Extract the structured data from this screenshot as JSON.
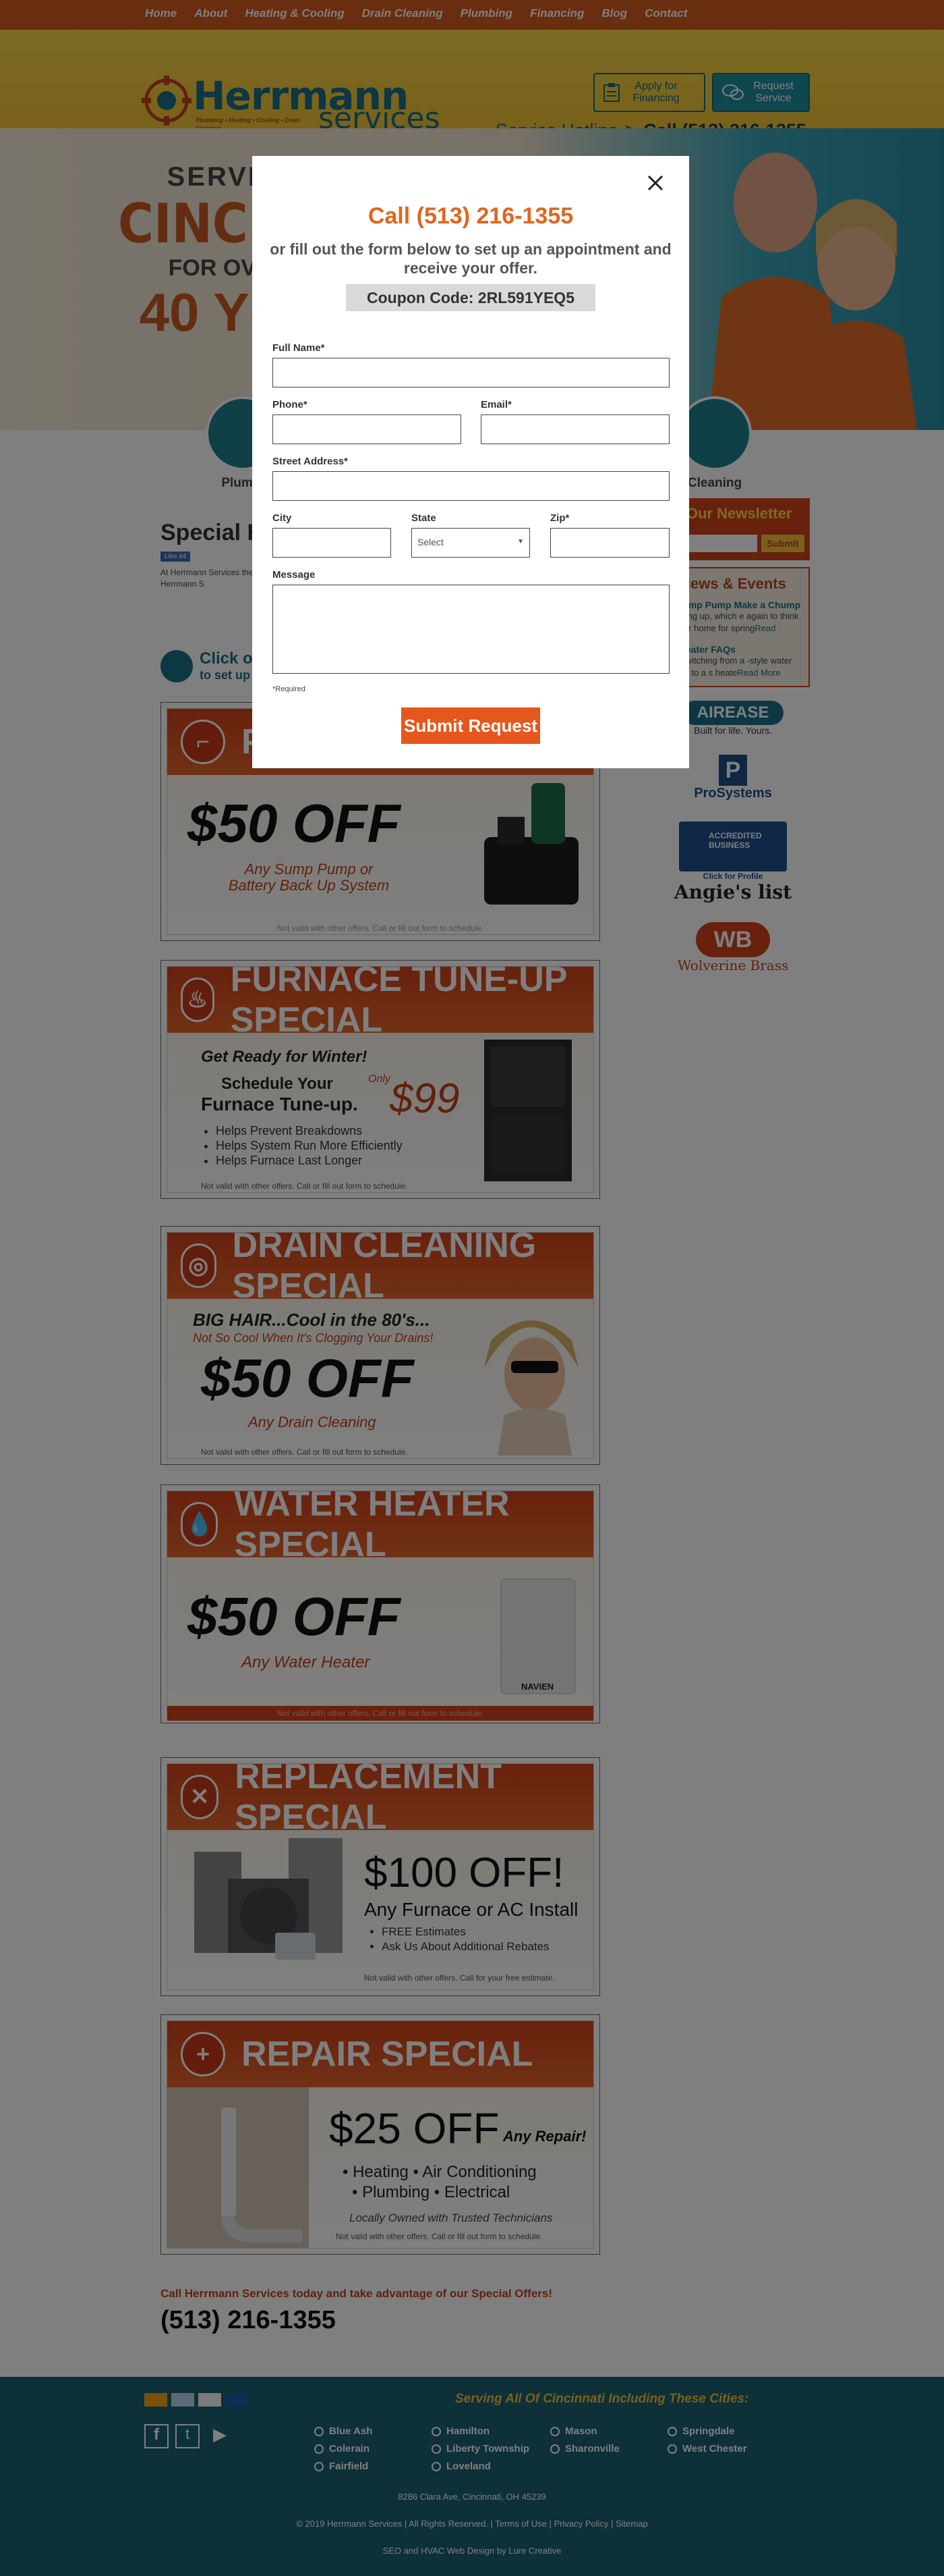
{
  "nav": {
    "items": [
      "Home",
      "About",
      "Heating & Cooling",
      "Drain Cleaning",
      "Plumbing",
      "Financing",
      "Blog",
      "Contact"
    ]
  },
  "header": {
    "logo_name": "Herrmann",
    "logo_services": "services",
    "logo_tagline": "Plumbing • Heating • Cooling • Drain Cleaning",
    "apply_label": "Apply for Financing",
    "request_label": "Request Service",
    "hotline_label": "Service Hotline ➤",
    "hotline_phone": "Call (513) 216-1355"
  },
  "hero": {
    "line1": "SERVI",
    "line2": "CINCIN",
    "line3": "FOR OV",
    "line4": "40 YE"
  },
  "services": [
    {
      "label": "Plumbi"
    },
    {
      "label": "Cleaning"
    }
  ],
  "main": {
    "title": "Special He",
    "like": "Like 44",
    "intro": "At Herrmann Services the special offers belo take advantage of an choosing Herrmann S",
    "click_text": "Click o",
    "click_sub": "to set up a"
  },
  "coupons": {
    "sump": {
      "banner": "P",
      "big": "$50 OFF",
      "sub": "Any Sump Pump or Battery Back Up System",
      "fine": "Not valid with other offers. Call or fill out form to schedule."
    },
    "furnace": {
      "banner": "FURNACE TUNE-UP SPECIAL",
      "head": "Get Ready for Winter!",
      "l1": "Schedule Your",
      "l2": "Furnace Tune-up.",
      "only": "Only",
      "price": "$99",
      "b1": "Helps Prevent Breakdowns",
      "b2": "Helps System Run More Efficiently",
      "b3": "Helps Furnace Last Longer",
      "fine": "Not valid with other offers. Call or fill out form to schedule."
    },
    "drain": {
      "banner": "DRAIN CLEANING SPECIAL",
      "head": "BIG HAIR...Cool in the 80's...",
      "head2": "Not So Cool When It's Clogging Your Drains!",
      "big": "$50 OFF",
      "sub": "Any Drain Cleaning",
      "fine": "Not valid with other offers. Call or fill out form to schedule."
    },
    "water": {
      "banner": "WATER HEATER SPECIAL",
      "big": "$50 OFF",
      "sub": "Any Water Heater",
      "brand": "NAVIEN",
      "fine": "Not valid with other offers. Call or fill out form to schedule."
    },
    "replace": {
      "banner": "REPLACEMENT SPECIAL",
      "big": "$100 OFF!",
      "sub": "Any Furnace or AC Install",
      "b1": "FREE Estimates",
      "b2": "Ask Us About Additional Rebates",
      "fine": "Not valid with other offers. Call for your free estimate."
    },
    "repair": {
      "banner": "REPAIR SPECIAL",
      "big": "$25 OFF",
      "any": "Any Repair!",
      "l1": "• Heating • Air Conditioning",
      "l2": "• Plumbing • Electrical",
      "l3": "Locally Owned with Trusted Technicians",
      "fine": "Not valid with other offers. Call or fill out form to schedule."
    }
  },
  "sidebar": {
    "newsletter_title": "e Our Newsletter",
    "newsletter_submit": "Submit",
    "news_title": "News & Events",
    "news1_title": "ur Sump Pump Make a Chump",
    "news1_text": "warming up, which e again to think about r home for spring",
    "news1_read": "Read",
    "news2_title": "ter Heater FAQs",
    "news2_text": "g of switching from a -style water heater to a s heate",
    "news2_read": "Read More",
    "airease": "AIREASE",
    "airease_tag": "Built for life. Yours.",
    "pro": "ProSystems",
    "bbb": "ACCREDITED BUSINESS",
    "bbb_click": "Click for Profile",
    "angies": "Angie's list",
    "wb": "WB",
    "wolverine": "Wolverine Brass"
  },
  "modal": {
    "call": "Call (513) 216-1355",
    "sub": "or fill out the form below to set up an appointment and receive your offer.",
    "coupon": "Coupon Code: 2RL591YEQ5",
    "full_name": "Full Name*",
    "phone": "Phone*",
    "email": "Email*",
    "street": "Street Address*",
    "city": "City",
    "state": "State",
    "state_select": "Select",
    "zip": "Zip*",
    "message": "Message",
    "required": "*Required",
    "submit": "Submit Request"
  },
  "cta": {
    "line1": "Call Herrmann Services today and take advantage of our Special Offers!",
    "phone": "(513) 216-1355"
  },
  "footer": {
    "serving": "Serving All Of Cincinnati Including These Cities:",
    "cities": [
      "Blue Ash",
      "Hamilton",
      "Mason",
      "Springdale",
      "Colerain",
      "Liberty Township",
      "Sharonville",
      "West Chester",
      "Fairfield",
      "Loveland"
    ],
    "address": "8286 Clara Ave, Cincinnati, OH 45239",
    "copyright": "© 2019 Herrmann Services | All Rights Reserved. | Terms of Use | Privacy Policy | Sitemap",
    "credit": "SEO and HVAC Web Design by Lure Creative"
  },
  "colors": {
    "accent": "#d25a1e",
    "teal": "#1a6e86",
    "yellow": "#f2c334"
  }
}
